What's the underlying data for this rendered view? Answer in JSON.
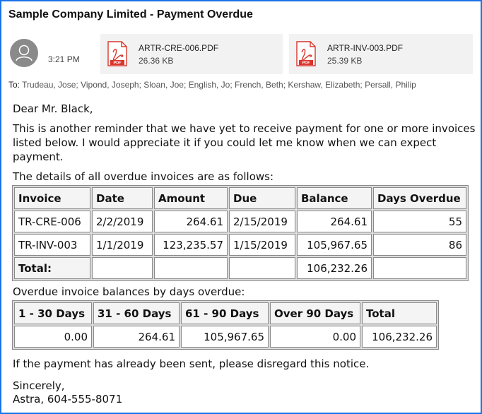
{
  "email": {
    "subject": "Sample Company Limited - Payment Overdue",
    "time": "3:21 PM",
    "to_label": "To:",
    "recipients": "Trudeau, Jose; Vipond, Joseph; Sloan, Joe; English, Jo; French, Beth; Kershaw, Elizabeth; Persall, Philip",
    "attachments": [
      {
        "name": "ARTR-CRE-006.PDF",
        "size": "26.36 KB",
        "icon": "pdf-icon"
      },
      {
        "name": "ARTR-INV-003.PDF",
        "size": "25.39 KB",
        "icon": "pdf-icon"
      }
    ],
    "greeting": "Dear Mr. Black,",
    "paragraph1": "This is another reminder that we have yet to receive payment for one or more invoices listed below. I would appreciate it if you could let me know when we can expect payment.",
    "details_label": "The details of all overdue invoices are as follows:",
    "invoice_table": {
      "headers": [
        "Invoice",
        "Date",
        "Amount",
        "Due",
        "Balance",
        "Days Overdue"
      ],
      "rows": [
        [
          "TR-CRE-006",
          "2/2/2019",
          "264.61",
          "2/15/2019",
          "264.61",
          "55"
        ],
        [
          "TR-INV-003",
          "1/1/2019",
          "123,235.57",
          "1/15/2019",
          "105,967.65",
          "86"
        ]
      ],
      "total_label": "Total:",
      "total_balance": "106,232.26"
    },
    "overdue_label": "Overdue invoice balances by days overdue:",
    "aging_table": {
      "headers": [
        "1 - 30 Days",
        "31 - 60 Days",
        "61 - 90 Days",
        "Over 90 Days",
        "Total"
      ],
      "values": [
        "0.00",
        "264.61",
        "105,967.65",
        "0.00",
        "106,232.26"
      ]
    },
    "closing": "If the payment has already been sent, please disregard this notice.",
    "sincerely": "Sincerely,",
    "signature": "Astra, 604-555-8071"
  },
  "colors": {
    "frame_border": "#1a73e8",
    "pdf_red": "#d9352b",
    "attachment_bg": "#f2f2f2",
    "avatar": "#8a8a8a"
  }
}
